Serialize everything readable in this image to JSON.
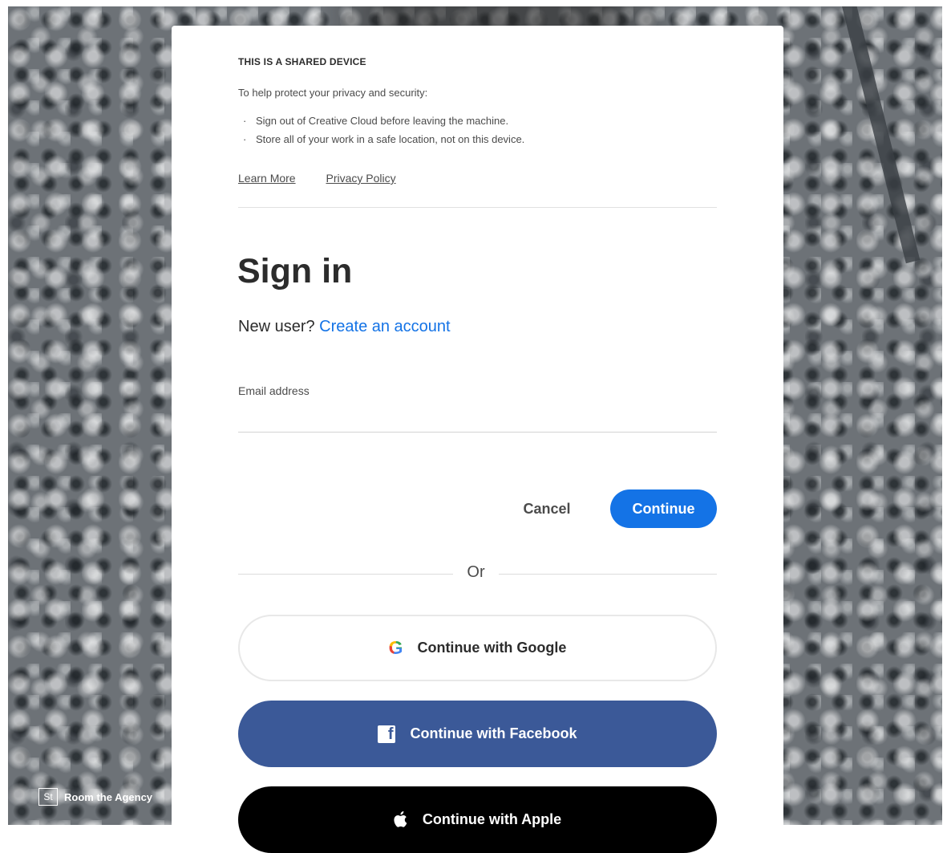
{
  "shared_device": {
    "title": "THIS IS A SHARED DEVICE",
    "intro": "To help protect your privacy and security:",
    "items": [
      {
        "bullet": "·",
        "text": "Sign out of Creative Cloud before leaving the machine."
      },
      {
        "bullet": "·",
        "text": "Store all of your work in a safe location, not on this device."
      }
    ],
    "learn_more": "Learn More",
    "privacy_policy": "Privacy Policy"
  },
  "signin": {
    "title": "Sign in",
    "new_user_prefix": "New user?",
    "create_account": "Create an account",
    "email_label": "Email address",
    "email_value": "",
    "cancel_label": "Cancel",
    "continue_label": "Continue",
    "or_label": "Or"
  },
  "social": {
    "google_label": "Continue with Google",
    "facebook_label": "Continue with Facebook",
    "apple_label": "Continue with Apple",
    "google_icon": "google-icon",
    "facebook_icon": "facebook-icon",
    "apple_icon": "apple-icon",
    "google_glyph": "G",
    "facebook_glyph": "f",
    "apple_glyph": ""
  },
  "credit": {
    "badge": "St",
    "text": "Room the Agency"
  },
  "colors": {
    "accent": "#1473e6",
    "facebook": "#3b5998",
    "apple": "#000000"
  }
}
